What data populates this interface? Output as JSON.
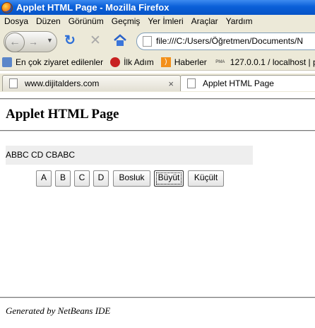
{
  "window": {
    "title": "Applet HTML Page - Mozilla Firefox"
  },
  "menu": [
    "Dosya",
    "Düzen",
    "Görünüm",
    "Geçmiş",
    "Yer İmleri",
    "Araçlar",
    "Yardım"
  ],
  "address": {
    "url": "file:///C:/Users/Öğretmen/Documents/N"
  },
  "bookmarks": [
    "En çok ziyaret edilenler",
    "İlk Adım",
    "Haberler",
    "127.0.0.1 / localhost | p..."
  ],
  "bookmark_badge": "PMA",
  "tabs": [
    {
      "label": "www.dijitalders.com",
      "close": "×"
    },
    {
      "label": "Applet HTML Page"
    }
  ],
  "page": {
    "heading": "Applet HTML Page",
    "applet_text": "ABBC CD  CBABC",
    "buttons": [
      "A",
      "B",
      "C",
      "D",
      "Bosluk",
      "Büyüt",
      "Küçült"
    ],
    "footer": "Generated by NetBeans IDE"
  },
  "colors": {
    "titlebar": "#0a5fd8",
    "chrome": "#ece9d8",
    "applet_bg": "#eeeeee"
  }
}
